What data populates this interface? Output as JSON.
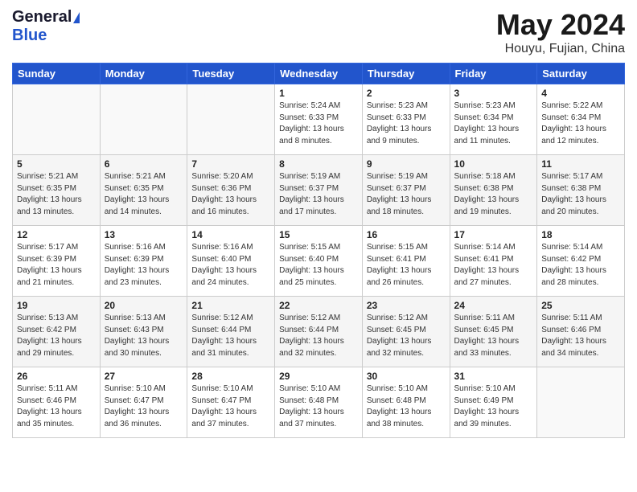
{
  "logo": {
    "general": "General",
    "blue": "Blue"
  },
  "title": "May 2024",
  "location": "Houyu, Fujian, China",
  "weekdays": [
    "Sunday",
    "Monday",
    "Tuesday",
    "Wednesday",
    "Thursday",
    "Friday",
    "Saturday"
  ],
  "weeks": [
    [
      {
        "day": "",
        "info": ""
      },
      {
        "day": "",
        "info": ""
      },
      {
        "day": "",
        "info": ""
      },
      {
        "day": "1",
        "info": "Sunrise: 5:24 AM\nSunset: 6:33 PM\nDaylight: 13 hours\nand 8 minutes."
      },
      {
        "day": "2",
        "info": "Sunrise: 5:23 AM\nSunset: 6:33 PM\nDaylight: 13 hours\nand 9 minutes."
      },
      {
        "day": "3",
        "info": "Sunrise: 5:23 AM\nSunset: 6:34 PM\nDaylight: 13 hours\nand 11 minutes."
      },
      {
        "day": "4",
        "info": "Sunrise: 5:22 AM\nSunset: 6:34 PM\nDaylight: 13 hours\nand 12 minutes."
      }
    ],
    [
      {
        "day": "5",
        "info": "Sunrise: 5:21 AM\nSunset: 6:35 PM\nDaylight: 13 hours\nand 13 minutes."
      },
      {
        "day": "6",
        "info": "Sunrise: 5:21 AM\nSunset: 6:35 PM\nDaylight: 13 hours\nand 14 minutes."
      },
      {
        "day": "7",
        "info": "Sunrise: 5:20 AM\nSunset: 6:36 PM\nDaylight: 13 hours\nand 16 minutes."
      },
      {
        "day": "8",
        "info": "Sunrise: 5:19 AM\nSunset: 6:37 PM\nDaylight: 13 hours\nand 17 minutes."
      },
      {
        "day": "9",
        "info": "Sunrise: 5:19 AM\nSunset: 6:37 PM\nDaylight: 13 hours\nand 18 minutes."
      },
      {
        "day": "10",
        "info": "Sunrise: 5:18 AM\nSunset: 6:38 PM\nDaylight: 13 hours\nand 19 minutes."
      },
      {
        "day": "11",
        "info": "Sunrise: 5:17 AM\nSunset: 6:38 PM\nDaylight: 13 hours\nand 20 minutes."
      }
    ],
    [
      {
        "day": "12",
        "info": "Sunrise: 5:17 AM\nSunset: 6:39 PM\nDaylight: 13 hours\nand 21 minutes."
      },
      {
        "day": "13",
        "info": "Sunrise: 5:16 AM\nSunset: 6:39 PM\nDaylight: 13 hours\nand 23 minutes."
      },
      {
        "day": "14",
        "info": "Sunrise: 5:16 AM\nSunset: 6:40 PM\nDaylight: 13 hours\nand 24 minutes."
      },
      {
        "day": "15",
        "info": "Sunrise: 5:15 AM\nSunset: 6:40 PM\nDaylight: 13 hours\nand 25 minutes."
      },
      {
        "day": "16",
        "info": "Sunrise: 5:15 AM\nSunset: 6:41 PM\nDaylight: 13 hours\nand 26 minutes."
      },
      {
        "day": "17",
        "info": "Sunrise: 5:14 AM\nSunset: 6:41 PM\nDaylight: 13 hours\nand 27 minutes."
      },
      {
        "day": "18",
        "info": "Sunrise: 5:14 AM\nSunset: 6:42 PM\nDaylight: 13 hours\nand 28 minutes."
      }
    ],
    [
      {
        "day": "19",
        "info": "Sunrise: 5:13 AM\nSunset: 6:42 PM\nDaylight: 13 hours\nand 29 minutes."
      },
      {
        "day": "20",
        "info": "Sunrise: 5:13 AM\nSunset: 6:43 PM\nDaylight: 13 hours\nand 30 minutes."
      },
      {
        "day": "21",
        "info": "Sunrise: 5:12 AM\nSunset: 6:44 PM\nDaylight: 13 hours\nand 31 minutes."
      },
      {
        "day": "22",
        "info": "Sunrise: 5:12 AM\nSunset: 6:44 PM\nDaylight: 13 hours\nand 32 minutes."
      },
      {
        "day": "23",
        "info": "Sunrise: 5:12 AM\nSunset: 6:45 PM\nDaylight: 13 hours\nand 32 minutes."
      },
      {
        "day": "24",
        "info": "Sunrise: 5:11 AM\nSunset: 6:45 PM\nDaylight: 13 hours\nand 33 minutes."
      },
      {
        "day": "25",
        "info": "Sunrise: 5:11 AM\nSunset: 6:46 PM\nDaylight: 13 hours\nand 34 minutes."
      }
    ],
    [
      {
        "day": "26",
        "info": "Sunrise: 5:11 AM\nSunset: 6:46 PM\nDaylight: 13 hours\nand 35 minutes."
      },
      {
        "day": "27",
        "info": "Sunrise: 5:10 AM\nSunset: 6:47 PM\nDaylight: 13 hours\nand 36 minutes."
      },
      {
        "day": "28",
        "info": "Sunrise: 5:10 AM\nSunset: 6:47 PM\nDaylight: 13 hours\nand 37 minutes."
      },
      {
        "day": "29",
        "info": "Sunrise: 5:10 AM\nSunset: 6:48 PM\nDaylight: 13 hours\nand 37 minutes."
      },
      {
        "day": "30",
        "info": "Sunrise: 5:10 AM\nSunset: 6:48 PM\nDaylight: 13 hours\nand 38 minutes."
      },
      {
        "day": "31",
        "info": "Sunrise: 5:10 AM\nSunset: 6:49 PM\nDaylight: 13 hours\nand 39 minutes."
      },
      {
        "day": "",
        "info": ""
      }
    ]
  ]
}
